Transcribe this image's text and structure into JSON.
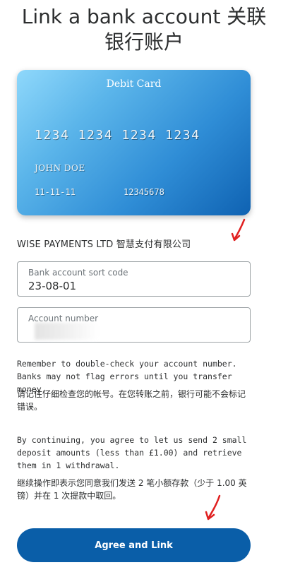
{
  "header": {
    "title_line1": "Link a bank account 关联",
    "title_line2": "银行账户"
  },
  "card": {
    "type_label": "Debit Card",
    "number": "1234 1234 1234 1234",
    "holder": "JOHN DOE",
    "expiry": "11-11-11",
    "account": "12345678",
    "colors": {
      "start": "#8fd8fb",
      "end": "#0f62b2"
    }
  },
  "company": {
    "name": "WISE PAYMENTS LTD 智慧支付有限公司"
  },
  "form": {
    "sort_code": {
      "label": "Bank account sort code",
      "value": "23-08-01"
    },
    "account_number": {
      "label": "Account number",
      "value": ""
    }
  },
  "notes": {
    "remember_en": "Remember to double-check your account number. Banks may not flag errors until you transfer money.",
    "remember_zh": "请记住仔细检查您的帐号。在您转账之前，银行可能不会标记错误。",
    "continue_en": "By continuing, you agree to let us send 2 small deposit amounts (less than £1.00) and retrieve them in 1 withdrawal.",
    "continue_zh": "继续操作即表示您同意我们发送 2 笔小额存款（少于 1.00 英镑）并在 1 次提款中取回。"
  },
  "actions": {
    "agree_label": "Agree and Link"
  },
  "colors": {
    "primary": "#0a5ea8",
    "annotation_arrow": "#e02020"
  },
  "icons": [
    "arrow-annotation-icon"
  ]
}
